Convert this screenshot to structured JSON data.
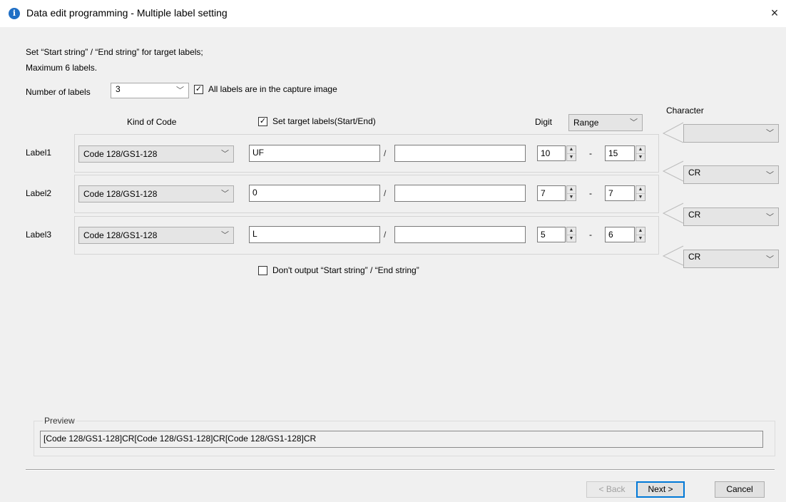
{
  "window": {
    "icon": "info-icon",
    "icon_glyph": "i",
    "title": "Data edit programming - Multiple label setting",
    "close_glyph": "×"
  },
  "instructions": {
    "line1": "Set “Start string” / “End string” for target labels;",
    "line2": "Maximum 6 labels."
  },
  "number_of_labels": {
    "label": "Number of labels",
    "value": "3"
  },
  "all_in_capture": {
    "checked": true,
    "label": "All labels are in the capture image"
  },
  "headers": {
    "kind_of_code": "Kind of Code",
    "set_target": "Set target labels(Start/End)",
    "digit": "Digit",
    "character": "Character"
  },
  "set_target_checked": true,
  "digit_mode": "Range",
  "labels": [
    {
      "name": "Label1",
      "code": "Code 128/GS1-128",
      "start": "UF",
      "end": "",
      "digit_from": "10",
      "digit_to": "15"
    },
    {
      "name": "Label2",
      "code": "Code 128/GS1-128",
      "start": "0",
      "end": "",
      "digit_from": "7",
      "digit_to": "7"
    },
    {
      "name": "Label3",
      "code": "Code 128/GS1-128",
      "start": "L",
      "end": "",
      "digit_from": "5",
      "digit_to": "6"
    }
  ],
  "slash": "/",
  "dash": "-",
  "characters": [
    "",
    "CR",
    "CR",
    "CR"
  ],
  "dont_output": {
    "checked": false,
    "label": "Don't output “Start string” / “End string”"
  },
  "preview": {
    "label": "Preview",
    "value": "[Code 128/GS1-128]CR[Code 128/GS1-128]CR[Code 128/GS1-128]CR"
  },
  "buttons": {
    "back": "< Back",
    "next": "Next >",
    "cancel": "Cancel"
  }
}
